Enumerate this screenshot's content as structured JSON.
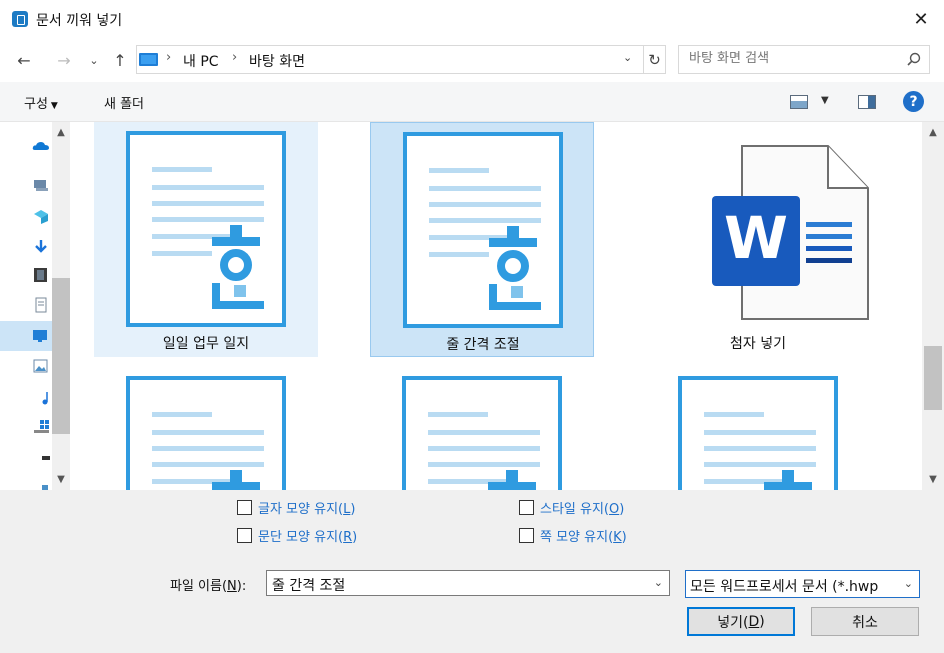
{
  "window": {
    "title": "문서 끼워 넣기",
    "app_icon": "hwp-app-icon"
  },
  "nav": {
    "breadcrumb": [
      "내 PC",
      "바탕 화면"
    ],
    "search_placeholder": "바탕 화면 검색"
  },
  "toolbar": {
    "organize_label": "구성",
    "new_folder_label": "새 폴더"
  },
  "sidebar": {
    "icons": [
      "onedrive-icon",
      "desktop-pc-icon",
      "3d-objects-icon",
      "downloads-icon",
      "videos-icon",
      "documents-icon",
      "desktop-icon",
      "pictures-icon",
      "music-icon",
      "windows-drive-icon",
      "network-drive-icon",
      "usb-drive-icon"
    ]
  },
  "files": [
    {
      "name": "일일 업무 일지",
      "type": "hwp",
      "state": "hover"
    },
    {
      "name": "줄 간격 조절",
      "type": "hwp",
      "state": "selected"
    },
    {
      "name": "첨자 넣기",
      "type": "word",
      "state": "normal"
    },
    {
      "name": "",
      "type": "hwp",
      "state": "normal"
    },
    {
      "name": "",
      "type": "hwp",
      "state": "normal"
    },
    {
      "name": "",
      "type": "hwp",
      "state": "normal"
    }
  ],
  "options": {
    "keep_char_shape": {
      "text": "글자 모양 유지(",
      "key": "L",
      "tail": ")",
      "checked": false
    },
    "keep_para_shape": {
      "text": "문단 모양 유지(",
      "key": "R",
      "tail": ")",
      "checked": false
    },
    "keep_style": {
      "text": "스타일 유지(",
      "key": "O",
      "tail": ")",
      "checked": false
    },
    "keep_page_shape": {
      "text": "쪽 모양 유지(",
      "key": "K",
      "tail": ")",
      "checked": false
    }
  },
  "filename": {
    "label": "파일 이름(",
    "key": "N",
    "tail": "):",
    "value": "줄 간격 조절"
  },
  "filetype": {
    "value": "모든 워드프로세서 문서 (*.hwp"
  },
  "buttons": {
    "insert_text": "넣기(",
    "insert_key": "D",
    "insert_tail": ")",
    "cancel": "취소"
  },
  "colors": {
    "accent": "#0078d7",
    "hwp_blue": "#2f9be0",
    "word_blue": "#185abd",
    "selection": "#cce4f7"
  }
}
